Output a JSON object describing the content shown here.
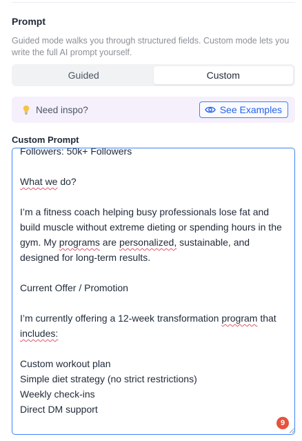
{
  "section": {
    "title": "Prompt",
    "description": "Guided mode walks you through structured fields. Custom mode lets you write the full AI prompt yourself."
  },
  "mode_toggle": {
    "options": [
      {
        "label": "Guided",
        "active": false
      },
      {
        "label": "Custom",
        "active": true
      }
    ]
  },
  "inspo": {
    "label": "Need inspo?",
    "button_label": "See Examples",
    "bulb_icon": "lightbulb-icon",
    "eye_icon": "eye-icon"
  },
  "custom_prompt": {
    "label": "Custom Prompt",
    "lines": [
      "Followers: 50k+ Followers",
      "",
      "What we do?",
      "",
      "I’m a fitness coach helping busy professionals lose fat and",
      "build muscle without extreme dieting or spending hours in the",
      "gym. My programs are personalized, sustainable, and",
      "designed for long-term results.",
      "",
      "Current Offer / Promotion",
      "",
      "I’m currently offering a 12-week transformation program that",
      "includes:",
      "",
      "Custom workout plan",
      "Simple diet strategy (no strict restrictions)",
      "Weekly check-ins",
      "Direct DM support"
    ],
    "spell_flagged_words": [
      "What we",
      "programs",
      "personalized,",
      "program",
      "includes:"
    ],
    "issue_count": "9"
  },
  "colors": {
    "accent": "#3b82f6",
    "inspo_bg": "#f5f0fc",
    "badge": "#e5533d",
    "spell_underline": "#e0566b"
  }
}
